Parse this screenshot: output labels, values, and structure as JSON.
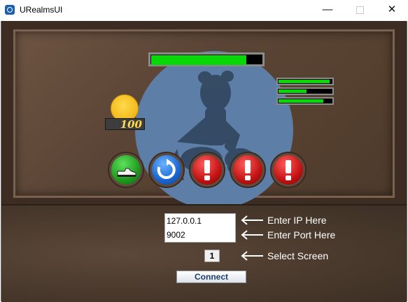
{
  "window": {
    "title": "URealmsUI",
    "minimize_glyph": "—",
    "close_glyph": "✕"
  },
  "hud": {
    "main_health_fraction": 0.86,
    "party_bars": [
      0.96,
      0.52,
      0.84
    ],
    "gold": "100",
    "abilities": [
      {
        "icon": "boot-icon",
        "color": "green"
      },
      {
        "icon": "refresh-icon",
        "color": "blue"
      },
      {
        "icon": "exclamation-icon",
        "color": "red"
      },
      {
        "icon": "exclamation-icon",
        "color": "red"
      },
      {
        "icon": "exclamation-icon",
        "color": "red"
      }
    ]
  },
  "connection": {
    "ip_value": "127.0.0.1",
    "port_value": "9002",
    "screen_value": "1",
    "ip_hint": "Enter IP Here",
    "port_hint": "Enter Port Here",
    "screen_hint": "Select Screen",
    "connect_label": "Connect"
  }
}
